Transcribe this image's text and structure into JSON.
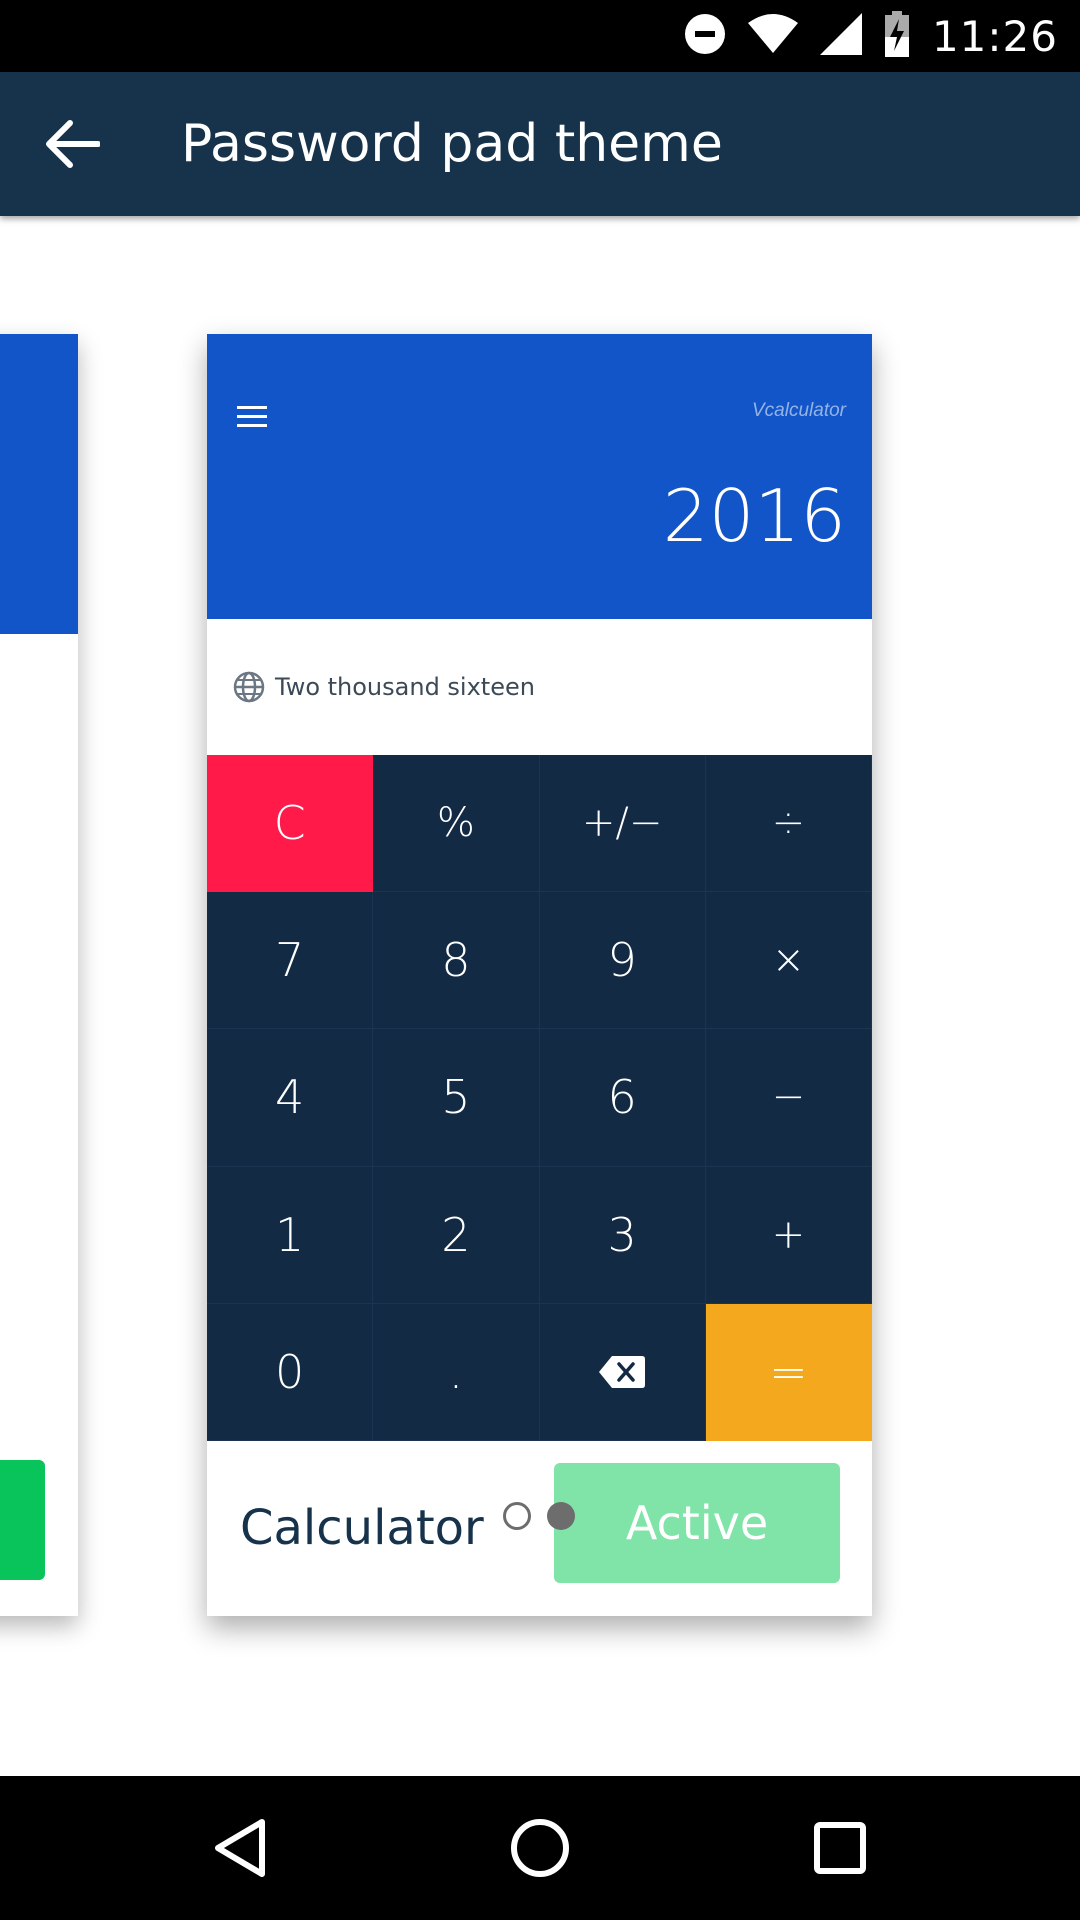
{
  "status_bar": {
    "time": "11:26",
    "icons": [
      "do-not-disturb-icon",
      "wifi-icon",
      "signal-icon",
      "battery-charging-icon"
    ]
  },
  "app_bar": {
    "back_icon": "arrow-back-icon",
    "title": "Password pad theme"
  },
  "theme_card": {
    "brand": "Vcalculator",
    "display_value": "2016",
    "words": "Two thousand  sixteen",
    "keys": [
      [
        "C",
        "%",
        "+/−",
        "÷"
      ],
      [
        "7",
        "8",
        "9",
        "×"
      ],
      [
        "4",
        "5",
        "6",
        "−"
      ],
      [
        "1",
        "2",
        "3",
        "+"
      ],
      [
        "0",
        ".",
        "",
        "="
      ]
    ],
    "footer_label": "Calculator",
    "action_label": "Active"
  },
  "pager": {
    "pages": 2,
    "current": 2
  },
  "colors": {
    "app_bar": "#16334b",
    "calc_header": "#1155c8",
    "keypad": "#132a45",
    "clear_key": "#ff1a4a",
    "equals_key": "#f3a81d",
    "active_button": "#80e4a8",
    "other_card_button": "#09c45a"
  },
  "nav_bar": {
    "icons": [
      "back-triangle-icon",
      "home-circle-icon",
      "recents-square-icon"
    ]
  }
}
